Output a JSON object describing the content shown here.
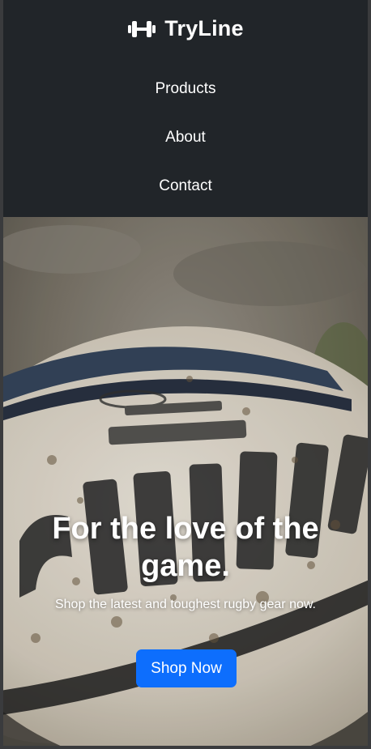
{
  "navbar": {
    "brand": {
      "icon": "dumbbell-icon",
      "name": "TryLine"
    },
    "links": [
      {
        "label": "Products"
      },
      {
        "label": "About"
      },
      {
        "label": "Contact"
      }
    ],
    "background_color": "#212529"
  },
  "hero": {
    "image": "muddy-rugby-ball-photo",
    "title": "For the love of the game.",
    "subtitle": "Shop the latest and toughest rugby gear now.",
    "cta_label": "Shop Now",
    "cta_color": "#0d6efd"
  }
}
